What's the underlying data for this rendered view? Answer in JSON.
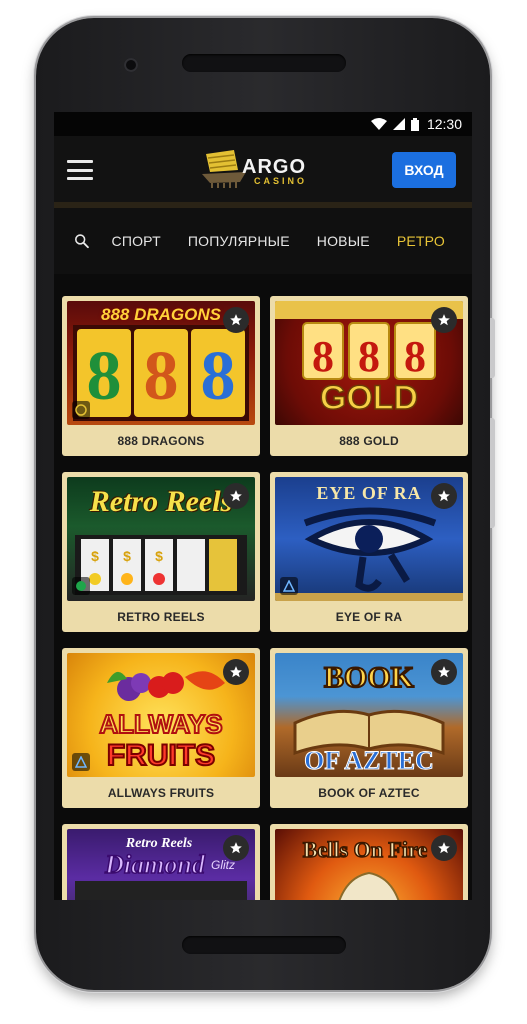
{
  "status_bar": {
    "time": "12:30"
  },
  "header": {
    "logo_main": "ARGO",
    "logo_sub": "CASINO",
    "login_label": "ВХОД"
  },
  "tabs": [
    {
      "label": "СПОРТ",
      "active": false
    },
    {
      "label": "ПОПУЛЯРНЫЕ",
      "active": false
    },
    {
      "label": "НОВЫЕ",
      "active": false
    },
    {
      "label": "РЕТРО",
      "active": true
    }
  ],
  "games": [
    {
      "title": "888 DRAGONS",
      "art_text": "888 DRAGONS"
    },
    {
      "title": "888 GOLD",
      "art_text": "888 GOLD"
    },
    {
      "title": "RETRO REELS",
      "art_text": "Retro Reels"
    },
    {
      "title": "EYE OF RA",
      "art_text": "EYE OF RA"
    },
    {
      "title": "ALLWAYS FRUITS",
      "art_text": "ALLWAYS FRUITS"
    },
    {
      "title": "BOOK OF AZTEC",
      "art_text": "BOOK OF AZTEC"
    },
    {
      "title": "",
      "art_text": "Retro Reels Diamond Glitz"
    },
    {
      "title": "",
      "art_text": "Bells On Fire"
    }
  ],
  "colors": {
    "accent": "#e8c437",
    "login_button": "#1b6fe0",
    "card_bg": "#ecdcaa"
  }
}
